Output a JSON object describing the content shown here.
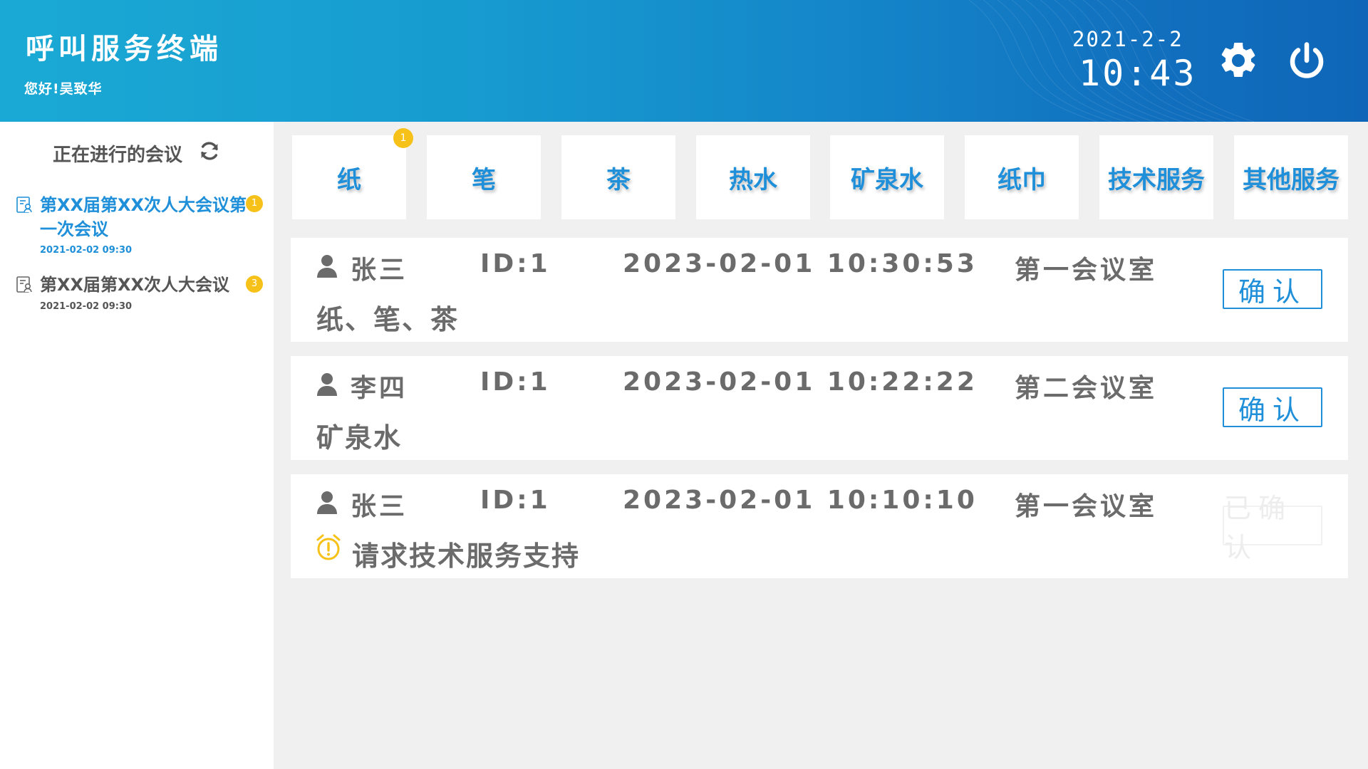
{
  "header": {
    "title": "呼叫服务终端",
    "greeting": "您好!吴致华",
    "date": "2021-2-2",
    "time": "10:43"
  },
  "sidebar": {
    "title": "正在进行的会议",
    "meetings": [
      {
        "title": "第XX届第XX次人大会议第一次会议",
        "time": "2021-02-02 09:30",
        "badge": "1",
        "active": true
      },
      {
        "title": "第XX届第XX次人大会议",
        "time": "2021-02-02 09:30",
        "badge": "3",
        "active": false
      }
    ]
  },
  "services": [
    {
      "label": "纸",
      "badge": "1"
    },
    {
      "label": "笔"
    },
    {
      "label": "茶"
    },
    {
      "label": "热水"
    },
    {
      "label": "矿泉水"
    },
    {
      "label": "纸巾"
    },
    {
      "label": "技术服务"
    },
    {
      "label": "其他服务"
    }
  ],
  "requests": [
    {
      "name": "张三",
      "id": "ID:1",
      "timestamp": "2023-02-01 10:30:53",
      "room": "第一会议室",
      "items": "纸、笔、茶",
      "status": "确认",
      "confirmed": false
    },
    {
      "name": "李四",
      "id": "ID:1",
      "timestamp": "2023-02-01 10:22:22",
      "room": "第二会议室",
      "items": "矿泉水",
      "status": "确认",
      "confirmed": false
    },
    {
      "name": "张三",
      "id": "ID:1",
      "timestamp": "2023-02-01 10:10:10",
      "room": "第一会议室",
      "items": "请求技术服务支持",
      "status": "已确认",
      "confirmed": true
    }
  ],
  "colors": {
    "accent": "#1e8fd8",
    "badge": "#f6c21a",
    "alarm": "#f6c21a",
    "text_gray": "#6b6b6b"
  }
}
